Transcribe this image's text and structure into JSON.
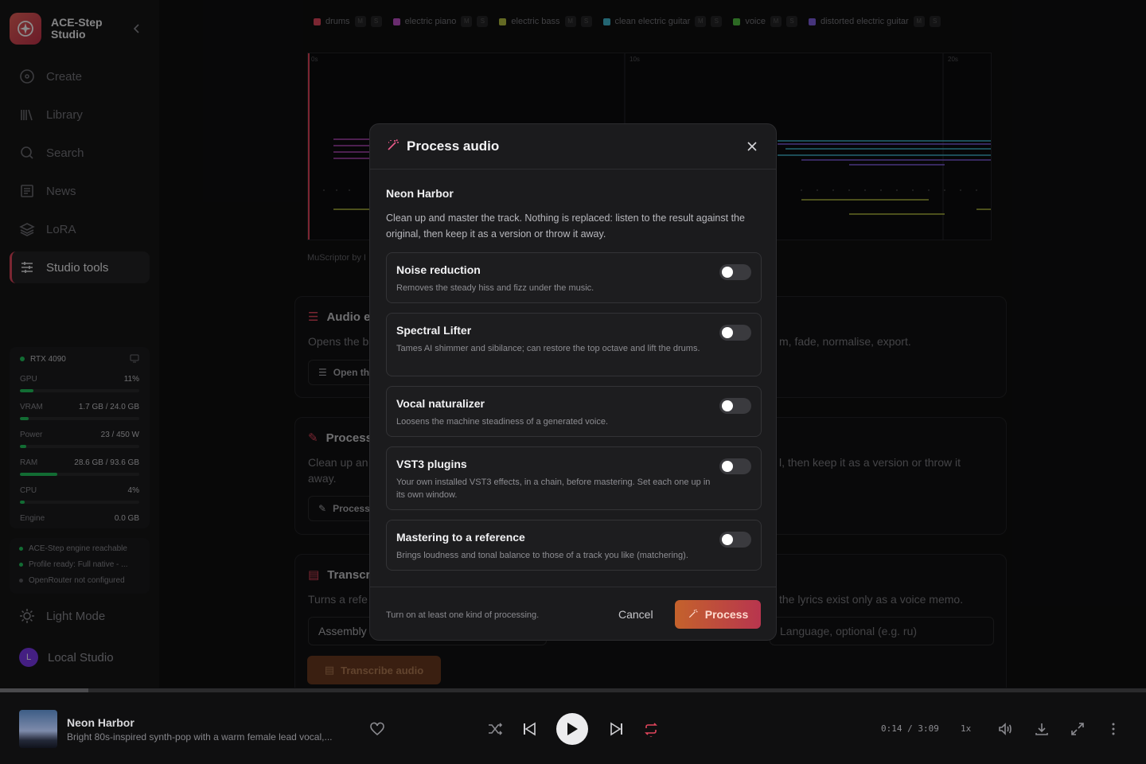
{
  "sidebar": {
    "brand": "ACE-Step Studio",
    "nav": [
      {
        "label": "Create",
        "icon": "disc-icon"
      },
      {
        "label": "Library",
        "icon": "library-icon"
      },
      {
        "label": "Search",
        "icon": "search-icon"
      },
      {
        "label": "News",
        "icon": "news-icon"
      },
      {
        "label": "LoRA",
        "icon": "layers-icon"
      },
      {
        "label": "Studio tools",
        "icon": "sliders-icon",
        "active": true
      }
    ],
    "gpu_name": "RTX 4090",
    "stats": [
      {
        "label": "GPU",
        "value": "11%",
        "fraction": 0.11
      },
      {
        "label": "VRAM",
        "value": "1.7 GB / 24.0 GB",
        "fraction": 0.07
      },
      {
        "label": "Power",
        "value": "23 / 450 W",
        "fraction": 0.05
      },
      {
        "label": "RAM",
        "value": "28.6 GB / 93.6 GB",
        "fraction": 0.31
      },
      {
        "label": "CPU",
        "value": "4%",
        "fraction": 0.04
      },
      {
        "label": "Engine",
        "value": "0.0 GB"
      }
    ],
    "status": [
      "ACE-Step engine reachable",
      "Profile ready: Full native - ...",
      "OpenRouter not configured"
    ],
    "theme": "Light Mode",
    "user_initial": "L",
    "user": "Local Studio"
  },
  "main": {
    "legend": [
      {
        "name": "drums",
        "color": "#e0455c"
      },
      {
        "name": "electric piano",
        "color": "#c050c8"
      },
      {
        "name": "electric bass",
        "color": "#b4c040"
      },
      {
        "name": "clean electric guitar",
        "color": "#40b8d0"
      },
      {
        "name": "voice",
        "color": "#50c040"
      },
      {
        "name": "distorted electric guitar",
        "color": "#8060e0"
      }
    ],
    "m_label": "M",
    "s_label": "S",
    "ticks": [
      "0s",
      "10s",
      "20s"
    ],
    "muscriptor": "MuScriptor by I",
    "audio_card": {
      "title": "Audio e",
      "text": "Opens the b",
      "text_right": "m, fade, normalise, export.",
      "btn": "Open th"
    },
    "process_card": {
      "title": "Process",
      "text": "Clean up an",
      "text2": "away.",
      "text_right": "l, then keep it as a version or throw it",
      "btn": "Process"
    },
    "transcribe_card": {
      "title": "Transcr",
      "text": "Turns a refe",
      "text_right": "the lyrics exist only as a voice memo.",
      "field1": "Assembly",
      "field2": "Language, optional (e.g. ru)",
      "btn": "Transcribe audio"
    }
  },
  "modal": {
    "title": "Process audio",
    "track": "Neon Harbor",
    "description": "Clean up and master the track. Nothing is replaced: listen to the result against the original, then keep it as a version or throw it away.",
    "options": [
      {
        "title": "Noise reduction",
        "desc": "Removes the steady hiss and fizz under the music.",
        "enabled": false
      },
      {
        "title": "Spectral Lifter",
        "desc": "Tames AI shimmer and sibilance; can restore the top octave and lift the drums.",
        "enabled": false
      },
      {
        "title": "Vocal naturalizer",
        "desc": "Loosens the machine steadiness of a generated voice.",
        "enabled": false
      },
      {
        "title": "VST3 plugins",
        "desc": "Your own installed VST3 effects, in a chain, before mastering. Set each one up in its own window.",
        "enabled": false
      },
      {
        "title": "Mastering to a reference",
        "desc": "Brings loudness and tonal balance to those of a track you like (matchering).",
        "enabled": false
      }
    ],
    "hint": "Turn on at least one kind of processing.",
    "cancel": "Cancel",
    "process": "Process"
  },
  "player": {
    "title": "Neon Harbor",
    "subtitle": "Bright 80s-inspired synth-pop with a warm female lead vocal,...",
    "time": "0:14 / 3:09",
    "speed": "1x",
    "progress_fraction": 0.077
  }
}
